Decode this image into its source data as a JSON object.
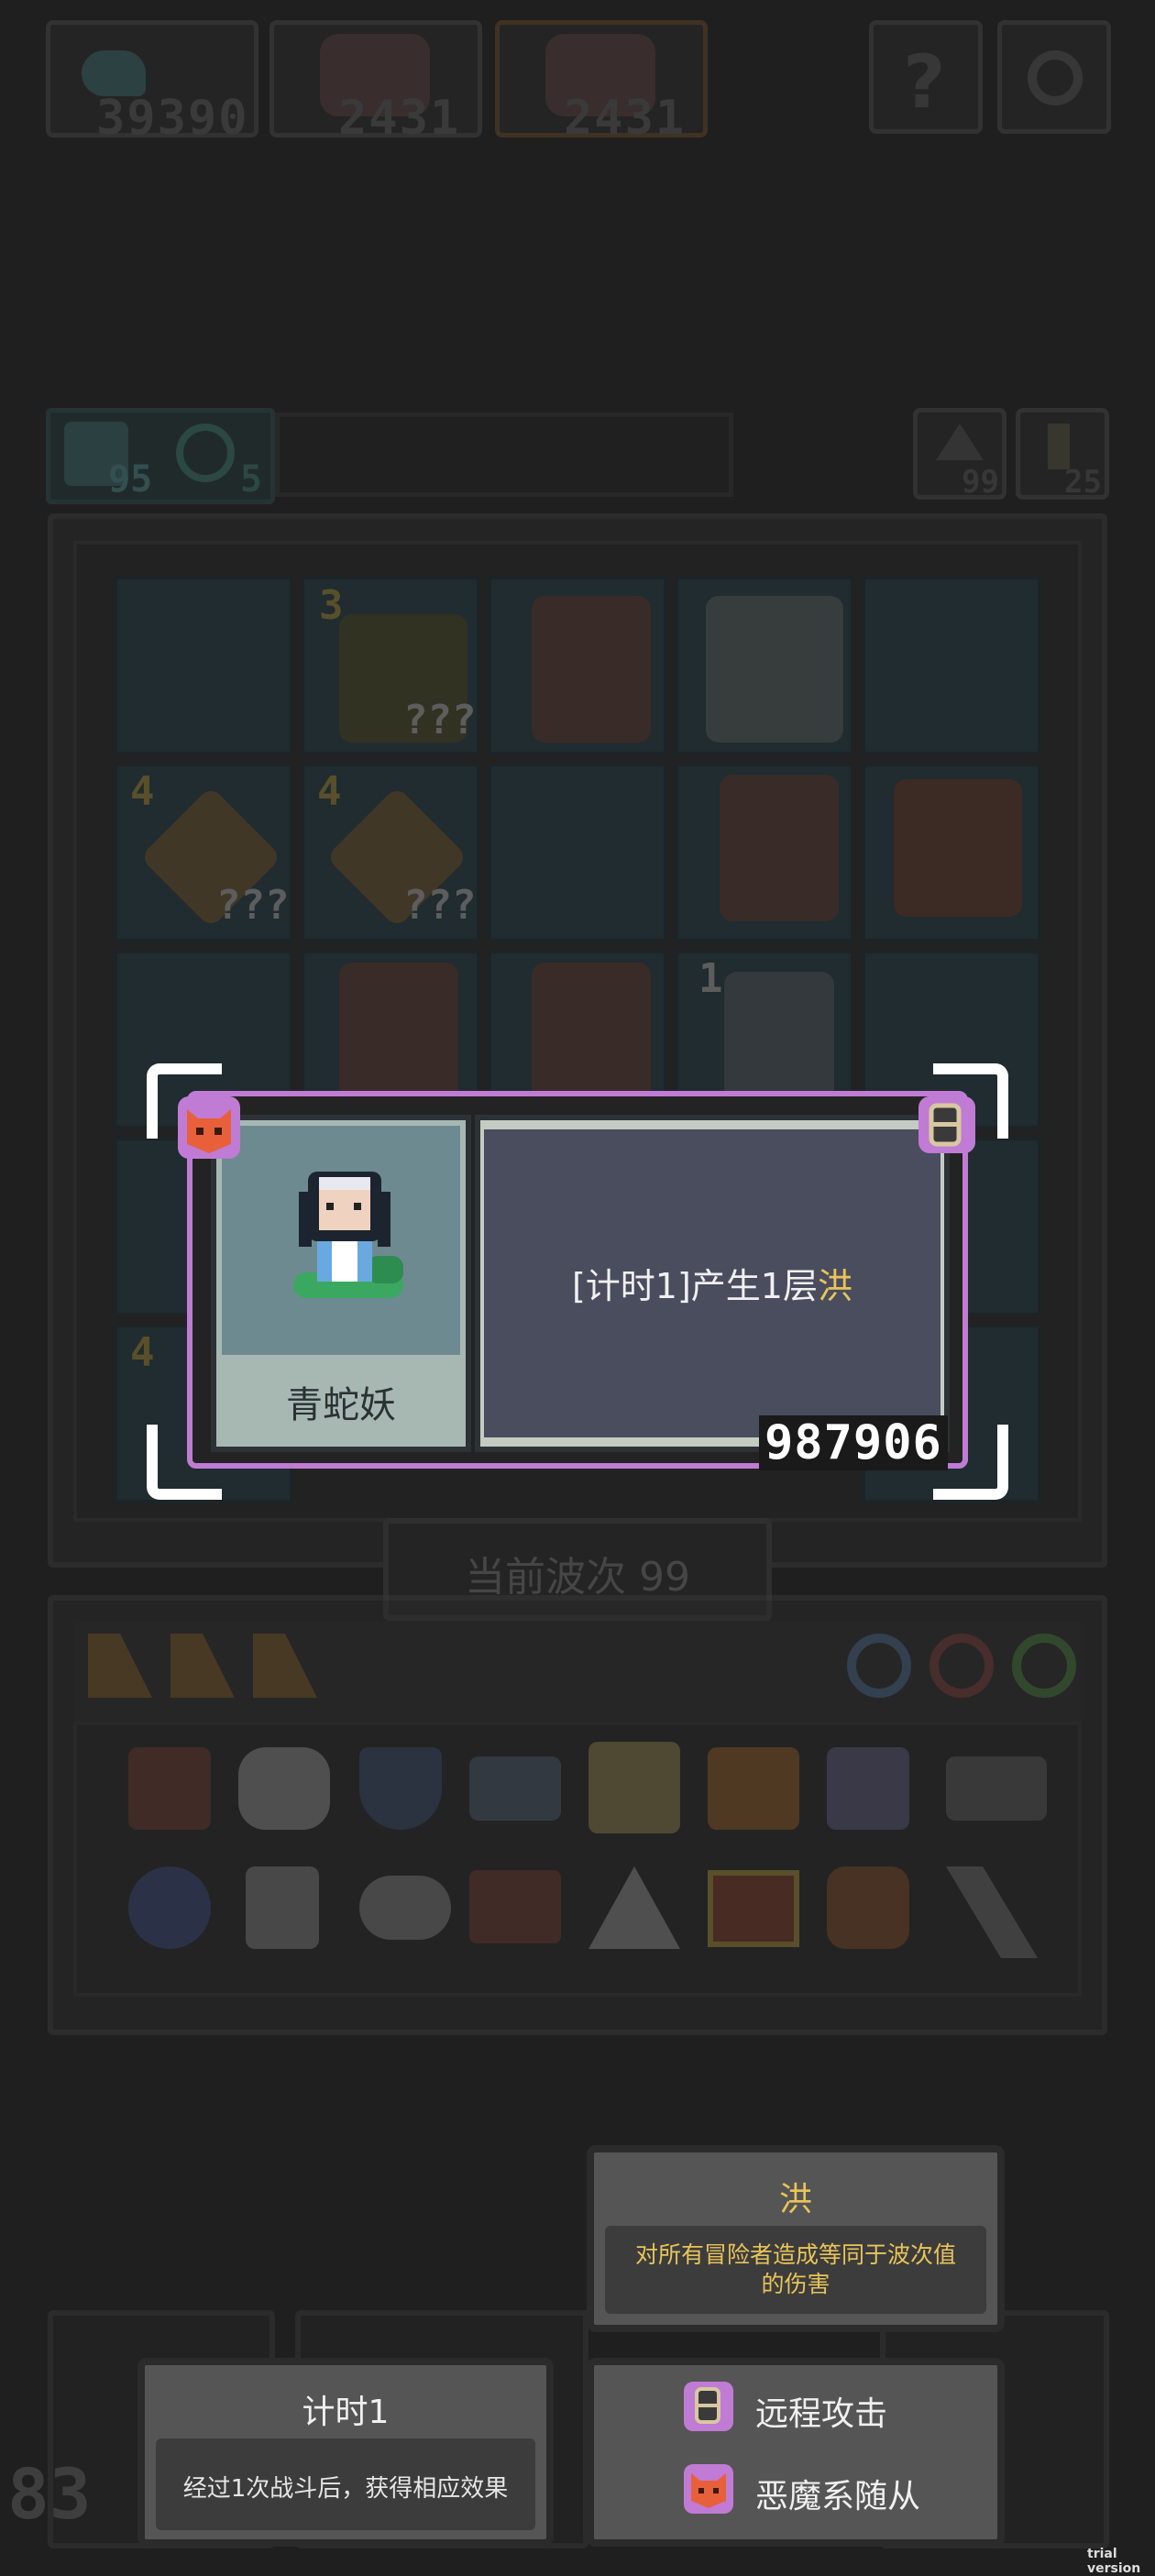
{
  "top_bar": {
    "resource_1": "39390",
    "resource_2": "2431",
    "resource_3": "2431"
  },
  "status_row": {
    "left_1": "95",
    "left_2": "5",
    "right_1": "99",
    "right_2": "25"
  },
  "board": {
    "level_tags": [
      "3",
      "4",
      "4",
      "1",
      "4"
    ],
    "unknown_labels": [
      "???",
      "???",
      "???"
    ]
  },
  "wave": {
    "label": "当前波次 99"
  },
  "card": {
    "name": "青蛇妖",
    "effect_prefix": "[计时1]产生1层",
    "effect_keyword": "洪",
    "id_number": "987906"
  },
  "tooltip_flood": {
    "title": "洪",
    "description": "对所有冒险者造成等同于波次值的伤害"
  },
  "tooltip_timer": {
    "title": "计时1",
    "description": "经过1次战斗后，获得相应效果"
  },
  "tooltip_tags": {
    "tag_1": "远程攻击",
    "tag_2": "恶魔系随从"
  },
  "bottom_left_counter": "83",
  "watermark": "trial version",
  "colors": {
    "accent_yellow": "#e8c45a",
    "card_border": "#c07bd4",
    "card_panel": "#4a4d5e",
    "portrait_bg": "#6e8a91"
  }
}
